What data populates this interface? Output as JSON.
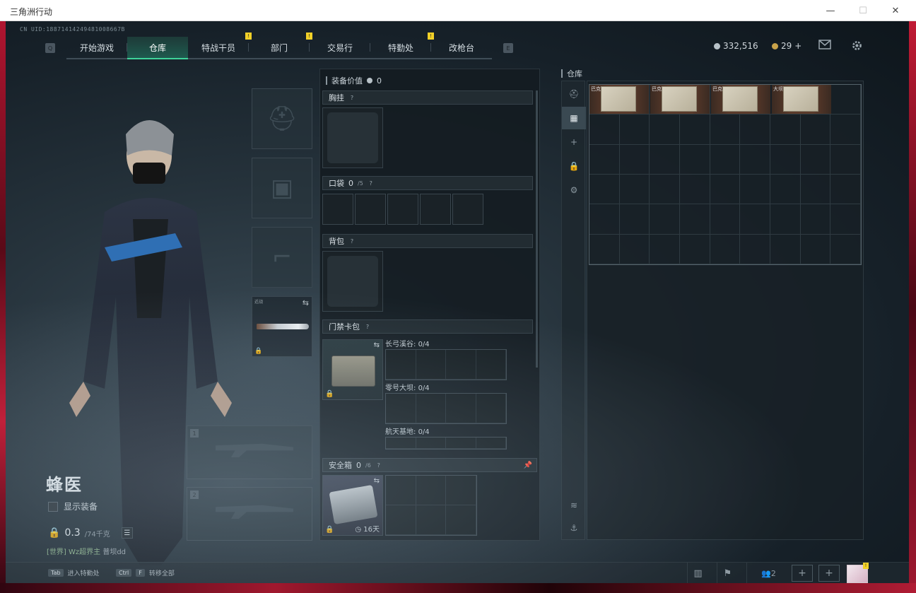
{
  "window": {
    "title": "三角洲行动",
    "minimize_glyph": "—",
    "maximize_glyph": "☐",
    "close_glyph": "✕"
  },
  "uid": "CN UID:18871414249481008667B",
  "nav": {
    "left_key": "Q",
    "right_key": "E",
    "tabs": [
      {
        "label": "开始游戏",
        "badge": ""
      },
      {
        "label": "仓库",
        "badge": ""
      },
      {
        "label": "特战干员",
        "badge": "!"
      },
      {
        "label": "部门",
        "badge": "!"
      },
      {
        "label": "交易行",
        "badge": ""
      },
      {
        "label": "特勤处",
        "badge": "!"
      },
      {
        "label": "改枪台",
        "badge": ""
      }
    ],
    "active_tab": "仓库"
  },
  "currency": {
    "silver": "332,516",
    "gold": "29",
    "gold_plus": "+"
  },
  "icons": {
    "mail": "mail-icon",
    "settings": "gear-icon"
  },
  "character": {
    "name": "蜂医",
    "show_equipment_label": "显示装备",
    "weight": "0.3",
    "weight_capacity": "/74千克",
    "chat_channel": "[世界]",
    "chat_user": "Wz超界主",
    "chat_message": "普坝dd"
  },
  "equipment_slots": {
    "melee_label": "近战",
    "gun1_num": "1",
    "gun2_num": "2"
  },
  "gear_panel": {
    "value_label": "装备价值",
    "value": "0",
    "chest_rig_label": "胸挂",
    "pocket_label": "口袋",
    "pocket_count": "0",
    "pocket_capacity": "/5",
    "backpack_label": "背包",
    "keycard_label": "门禁卡包",
    "keycard_rows": [
      {
        "name": "长弓溪谷:",
        "count": "0/4"
      },
      {
        "name": "零号大坝:",
        "count": "0/4"
      },
      {
        "name": "航天基地:",
        "count": "0/4"
      }
    ],
    "safe_label": "安全箱",
    "safe_count": "0",
    "safe_capacity": "/6",
    "safe_days": "16天"
  },
  "stash": {
    "label": "仓库",
    "items": [
      {
        "label": "巴克"
      },
      {
        "label": "巴克"
      },
      {
        "label": "巴克"
      },
      {
        "label": "大坝"
      }
    ]
  },
  "bottom": {
    "hint1_key": "Tab",
    "hint1_text": "进入特勤处",
    "hint2_key1": "Ctrl",
    "hint2_key2": "F",
    "hint2_text": "转移全部",
    "friends_count": "2",
    "avatar_badge": "!"
  }
}
